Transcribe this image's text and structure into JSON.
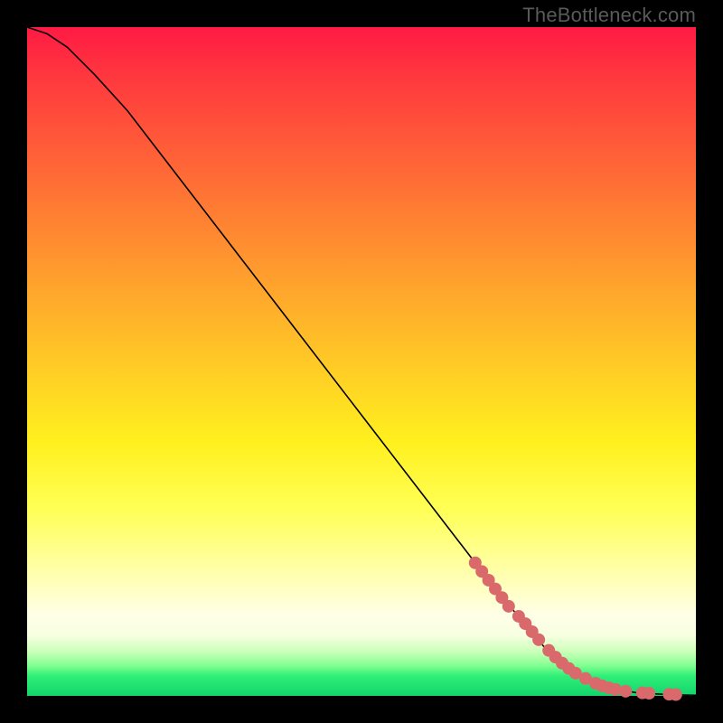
{
  "watermark": "TheBottleneck.com",
  "chart_data": {
    "type": "line",
    "title": "",
    "xlabel": "",
    "ylabel": "",
    "x_range": [
      0,
      100
    ],
    "y_range": [
      0,
      100
    ],
    "series": [
      {
        "name": "curve",
        "x": [
          0,
          3,
          6,
          10,
          15,
          20,
          30,
          40,
          50,
          60,
          70,
          78,
          84,
          88,
          91,
          94,
          97,
          100
        ],
        "y": [
          100,
          99,
          97,
          93,
          87.5,
          81,
          68,
          55,
          42,
          29,
          16,
          6.5,
          2.5,
          1.0,
          0.5,
          0.3,
          0.15,
          0.1
        ]
      }
    ],
    "markers": [
      {
        "name": "highlighted-points",
        "points": [
          {
            "x": 67,
            "y": 19.9
          },
          {
            "x": 68,
            "y": 18.6
          },
          {
            "x": 69,
            "y": 17.3
          },
          {
            "x": 70,
            "y": 16.0
          },
          {
            "x": 71,
            "y": 14.7
          },
          {
            "x": 72,
            "y": 13.4
          },
          {
            "x": 73.5,
            "y": 11.9
          },
          {
            "x": 74.5,
            "y": 10.8
          },
          {
            "x": 75.5,
            "y": 9.6
          },
          {
            "x": 76.5,
            "y": 8.4
          },
          {
            "x": 78,
            "y": 6.8
          },
          {
            "x": 79,
            "y": 5.8
          },
          {
            "x": 80,
            "y": 4.9
          },
          {
            "x": 81,
            "y": 4.1
          },
          {
            "x": 82,
            "y": 3.4
          },
          {
            "x": 83.5,
            "y": 2.6
          },
          {
            "x": 85,
            "y": 1.9
          },
          {
            "x": 86,
            "y": 1.5
          },
          {
            "x": 87,
            "y": 1.2
          },
          {
            "x": 88,
            "y": 0.95
          },
          {
            "x": 89.5,
            "y": 0.7
          },
          {
            "x": 92,
            "y": 0.45
          },
          {
            "x": 93,
            "y": 0.4
          },
          {
            "x": 96,
            "y": 0.25
          },
          {
            "x": 97,
            "y": 0.2
          }
        ]
      }
    ],
    "colors": {
      "marker": "#d9696b",
      "line": "#000000",
      "gradient_top": "#ff1a44",
      "gradient_bottom": "#12d46c"
    }
  }
}
